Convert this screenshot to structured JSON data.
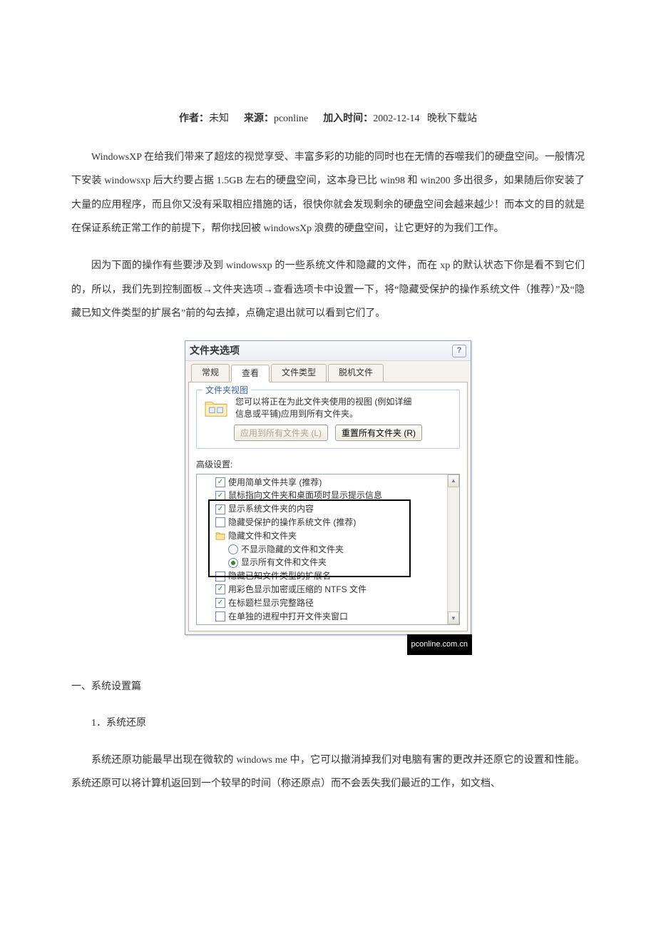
{
  "meta": {
    "author_label": "作者：",
    "author": "未知",
    "source_label": "来源：",
    "source": "pconline",
    "time_label": "加入时间：",
    "time": "2002-12-14",
    "site": "晚秋下载站"
  },
  "paragraphs": {
    "p1": "WindowsXP 在给我们带来了超炫的视觉享受、丰富多彩的功能的同时也在无情的吞噬我们的硬盘空间。一般情况下安装 windowsxp 后大约要占据 1.5GB 左右的硬盘空间，这本身已比 win98 和 win200 多出很多，如果随后你安装了大量的应用程序，而且你又没有采取相应措施的话，很快你就会发现剩余的硬盘空间会越来越少！而本文的目的就是在保证系统正常工作的前提下，帮你找回被 windowsXp 浪费的硬盘空间，让它更好的为我们工作。",
    "p2": "因为下面的操作有些要涉及到 windowsxp 的一些系统文件和隐藏的文件，而在 xp 的默认状态下你是看不到它们的，所以，我们先到控制面板→文件夹选项→查看选项卡中设置一下，将“隐藏受保护的操作系统文件（推荐）”及“隐藏已知文件类型的扩展名”前的勾去掉，点确定退出就可以看到它们了。",
    "h1": "一、系统设置篇",
    "item1": "1．系统还原",
    "p3": "系统还原功能最早出现在微软的 windows me 中，它可以撤消掉我们对电脑有害的更改并还原它的设置和性能。系统还原可以将计算机返回到一个较早的时间（称还原点）而不会丢失我们最近的工作，如文档、"
  },
  "dialog": {
    "title": "文件夹选项",
    "help": "?",
    "tabs": [
      "常规",
      "查看",
      "文件类型",
      "脱机文件"
    ],
    "group_title": "文件夹视图",
    "view_desc_l1": "您可以将正在为此文件夹使用的视图 (例如详细",
    "view_desc_l2": "信息或平铺)应用到所有文件夹。",
    "btn_apply": "应用到所有文件夹 (L)",
    "btn_reset": "重置所有文件夹 (R)",
    "adv_label": "高级设置:",
    "items": {
      "i0": "使用简单文件共享 (推荐)",
      "i1": "鼠标指向文件夹和桌面项时显示提示信息",
      "i2": "显示系统文件夹的内容",
      "i3": "隐藏受保护的操作系统文件 (推荐)",
      "i4": "隐藏文件和文件夹",
      "i5": "不显示隐藏的文件和文件夹",
      "i6": "显示所有文件和文件夹",
      "i7": "隐藏已知文件类型的扩展名",
      "i8": "用彩色显示加密或压缩的 NTFS 文件",
      "i9": "在标题栏显示完整路径",
      "i10": "在单独的进程中打开文件夹窗口"
    },
    "watermark": "pconline.com.cn"
  }
}
